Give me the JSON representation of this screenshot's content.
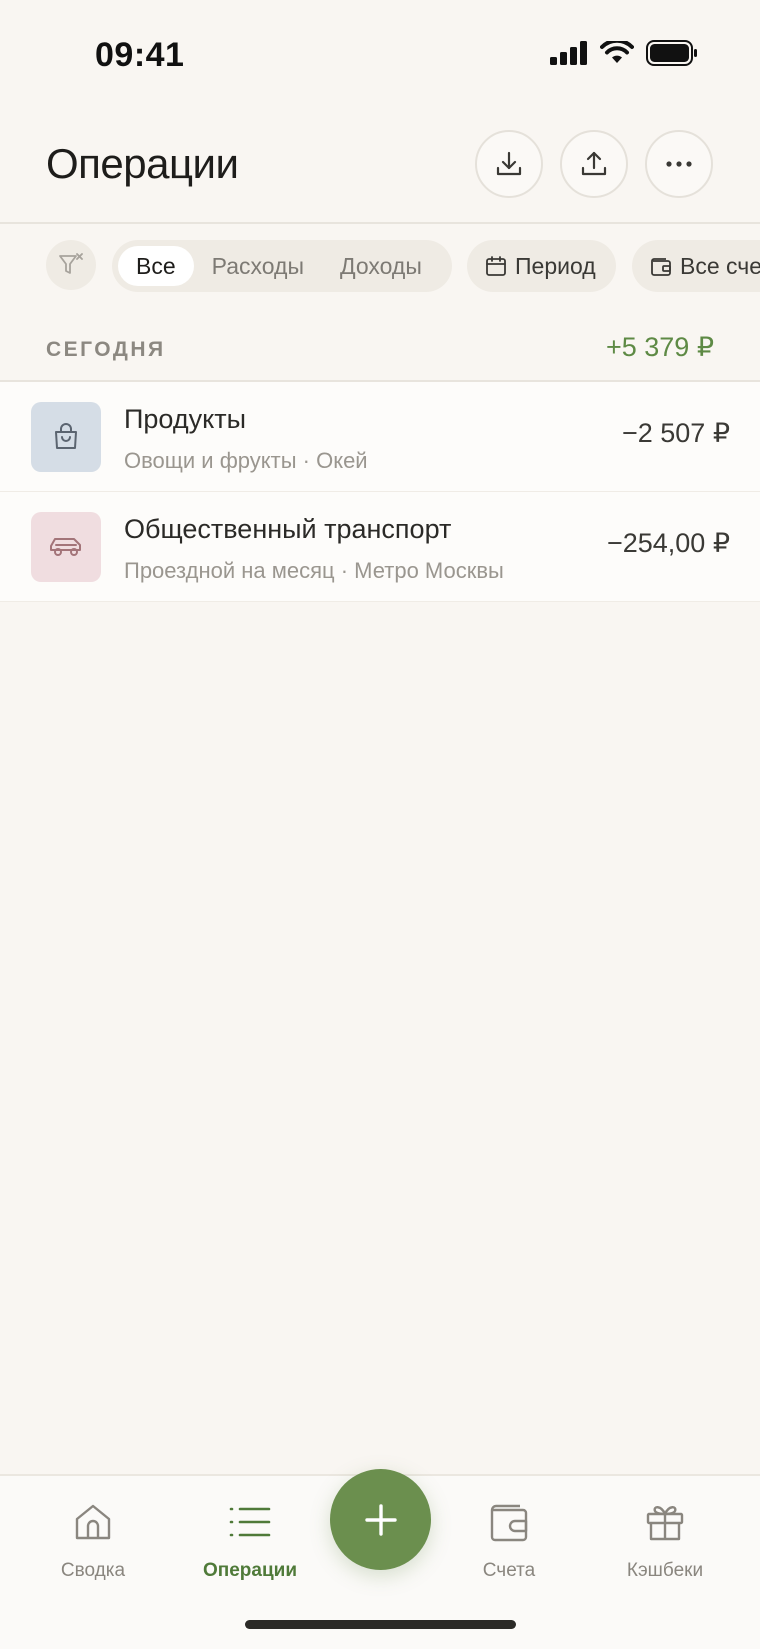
{
  "status_bar": {
    "time": "09:41"
  },
  "header": {
    "title": "Операции"
  },
  "filters": {
    "segments": [
      "Все",
      "Расходы",
      "Доходы"
    ],
    "selected": "Все",
    "period_label": "Период",
    "accounts_label": "Все счета"
  },
  "section": {
    "title": "СЕГОДНЯ",
    "total": "+5 379 ₽"
  },
  "operations": [
    {
      "title": "Продукты",
      "subtitle": "Овощи и фрукты · Окей",
      "amount": "−2 507 ₽",
      "icon": "shopping-bag-icon",
      "icon_bg": "#d5dde6"
    },
    {
      "title": "Общественный транспорт",
      "subtitle": "Проездной на месяц · Метро Москвы",
      "amount": "−254,00 ₽",
      "icon": "car-icon",
      "icon_bg": "#f0dde0"
    }
  ],
  "tabbar": {
    "tabs": [
      {
        "label": "Сводка",
        "icon": "home-icon"
      },
      {
        "label": "Операции",
        "icon": "list-icon"
      },
      {
        "label": "Счета",
        "icon": "wallet-icon"
      },
      {
        "label": "Кэшбеки",
        "icon": "gift-icon"
      }
    ],
    "active": "Операции",
    "fab_icon": "plus-icon"
  },
  "colors": {
    "accent": "#6b8f4e",
    "positive": "#5e8a45",
    "background": "#f9f6f2"
  }
}
